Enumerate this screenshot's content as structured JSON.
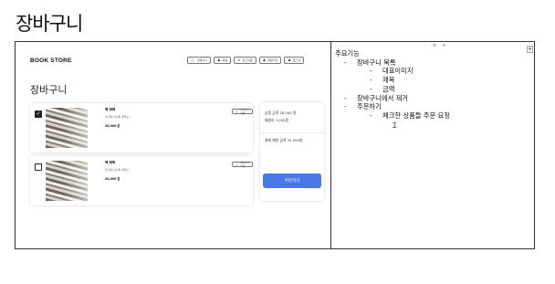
{
  "page": {
    "title": "장바구니"
  },
  "mock": {
    "brand": "BOOK STORE",
    "nav": [
      {
        "icon": "cart-icon",
        "glyph": "🛒",
        "label": "장바구니"
      },
      {
        "icon": "user-icon",
        "glyph": "♟",
        "label": "회원"
      },
      {
        "icon": "login-icon",
        "glyph": "⊘",
        "label": "로그아웃"
      },
      {
        "icon": "user-icon",
        "glyph": "♟",
        "label": "회원가입"
      },
      {
        "icon": "user-icon",
        "glyph": "♟",
        "label": "로그인"
      }
    ],
    "heading": "장바구니",
    "items": [
      {
        "checked": true,
        "title": "책 제목",
        "desc": "책 설명 간단히 올려요...",
        "price": "20,000 원",
        "delete_label": "장바구니 삭제"
      },
      {
        "checked": false,
        "title": "책 제목",
        "desc": "책 설명 간단히 올려요...",
        "price": "20,000 원",
        "delete_label": "장바구니 삭제"
      }
    ],
    "summary": {
      "product_total": "상품 금액 28,000 원",
      "shipping": "배송비 3,000원",
      "expected_total": "결제 예정 금액 31,000원",
      "order_button": "주문하기"
    }
  },
  "notes": {
    "lines": [
      {
        "level": 0,
        "text": "주요기능"
      },
      {
        "level": 1,
        "text": "장바구니 목록"
      },
      {
        "level": 2,
        "text": "대표이미지"
      },
      {
        "level": 2,
        "text": "제목"
      },
      {
        "level": 2,
        "text": "금액"
      },
      {
        "level": 1,
        "text": "장바구니에서 제거"
      },
      {
        "level": 1,
        "text": "주문하기"
      },
      {
        "level": 2,
        "text": "체크한 상품들 주문 요청"
      }
    ]
  }
}
